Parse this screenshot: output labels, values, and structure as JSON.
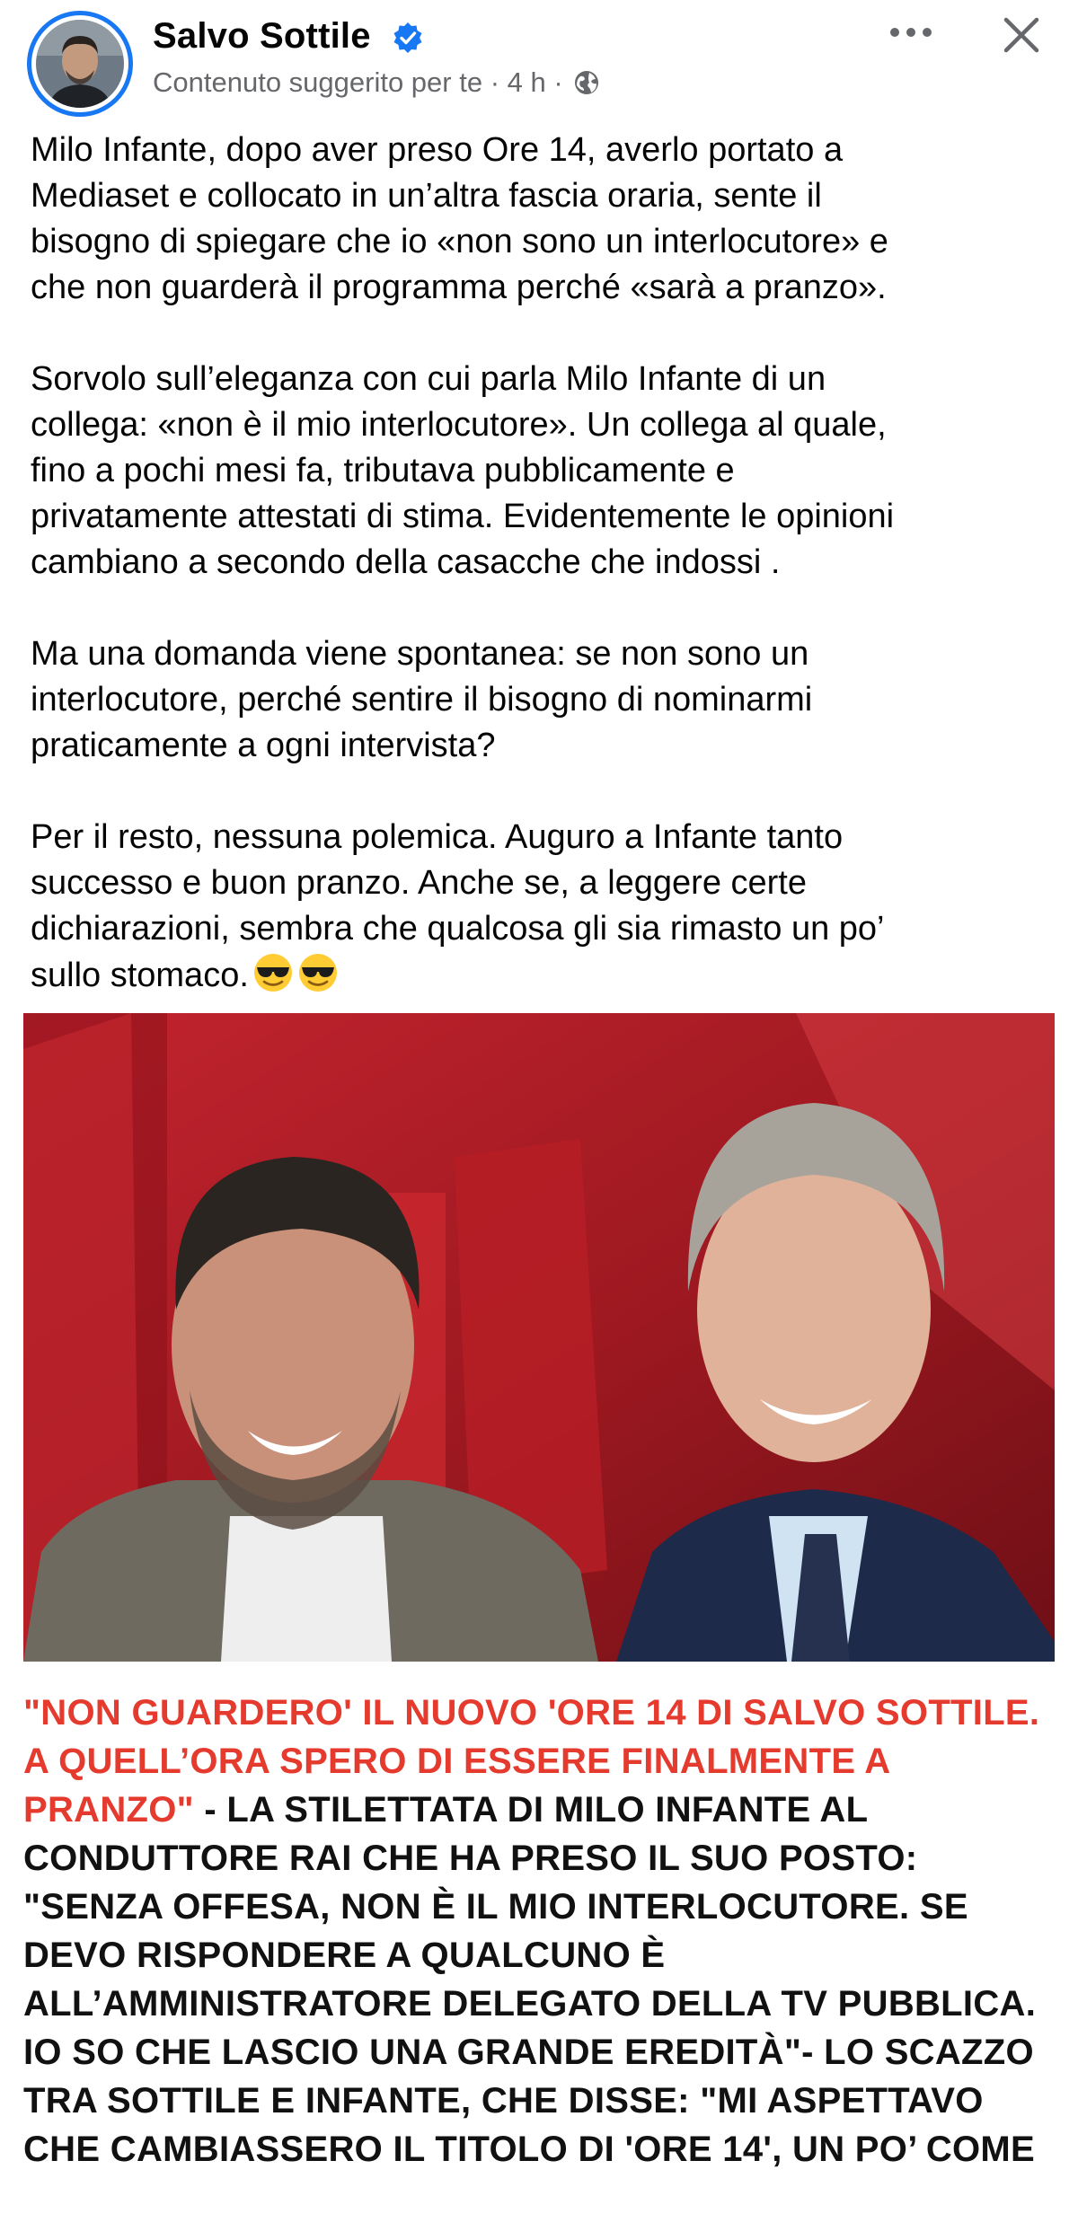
{
  "header": {
    "author_name": "Salvo Sottile",
    "meta_text": "Contenuto suggerito per te · 4 h ·",
    "icons": {
      "avatar": "profile-photo",
      "verified": "verified-badge-icon",
      "audience": "globe-icon",
      "more": "more-options-icon",
      "close": "close-icon"
    },
    "accent_color": "#1877f2"
  },
  "post": {
    "paragraphs": [
      "Milo Infante, dopo aver preso Ore 14, averlo portato a\nMediaset e collocato in un’altra fascia oraria, sente il\nbisogno di spiegare che io «non sono un interlocutore» e\nche non guarderà il programma perché «sarà a pranzo».",
      "Sorvolo sull’eleganza con cui parla Milo Infante di un\ncollega: «non è il mio interlocutore». Un collega al quale,\nfino a pochi mesi fa, tributava pubblicamente e\nprivatamente attestati di stima. Evidentemente le opinioni\ncambiano a secondo della casacche che indossi .",
      "Ma una domanda viene spontanea: se non sono un\ninterlocutore, perché sentire il bisogno di nominarmi\npraticamente a ogni intervista?",
      "Per il resto, nessuna polemica. Auguro a Infante tanto\nsuccesso e buon pranzo. Anche se, a leggere certe\ndichiarazioni, sembra che qualcosa gli sia rimasto un po’\nsullo stomaco."
    ],
    "emojis": [
      "smiling-face-with-sunglasses",
      "smiling-face-with-sunglasses"
    ]
  },
  "image": {
    "description_icon": "photo-two-tv-hosts",
    "background_color": "#b3202a"
  },
  "headline": {
    "red_part": "\"NON GUARDERO' IL NUOVO 'ORE 14 DI SALVO SOTTILE. A QUELL’ORA SPERO DI ESSERE FINALMENTE A PRANZO\"",
    "black_part": " - LA STILETTATA DI MILO INFANTE AL CONDUTTORE RAI CHE HA PRESO IL SUO POSTO: \"SENZA OFFESA, NON È IL MIO INTERLOCUTORE. SE DEVO RISPONDERE A QUALCUNO È ALL’AMMINISTRATORE DELEGATO DELLA TV PUBBLICA. IO SO CHE LASCIO UNA GRANDE EREDITÀ\"- LO SCAZZO TRA SOTTILE E INFANTE, CHE DISSE: \"MI ASPETTAVO CHE CAMBIASSERO IL TITOLO DI 'ORE 14', UN PO’ COME",
    "red_color": "#e53b2e"
  }
}
